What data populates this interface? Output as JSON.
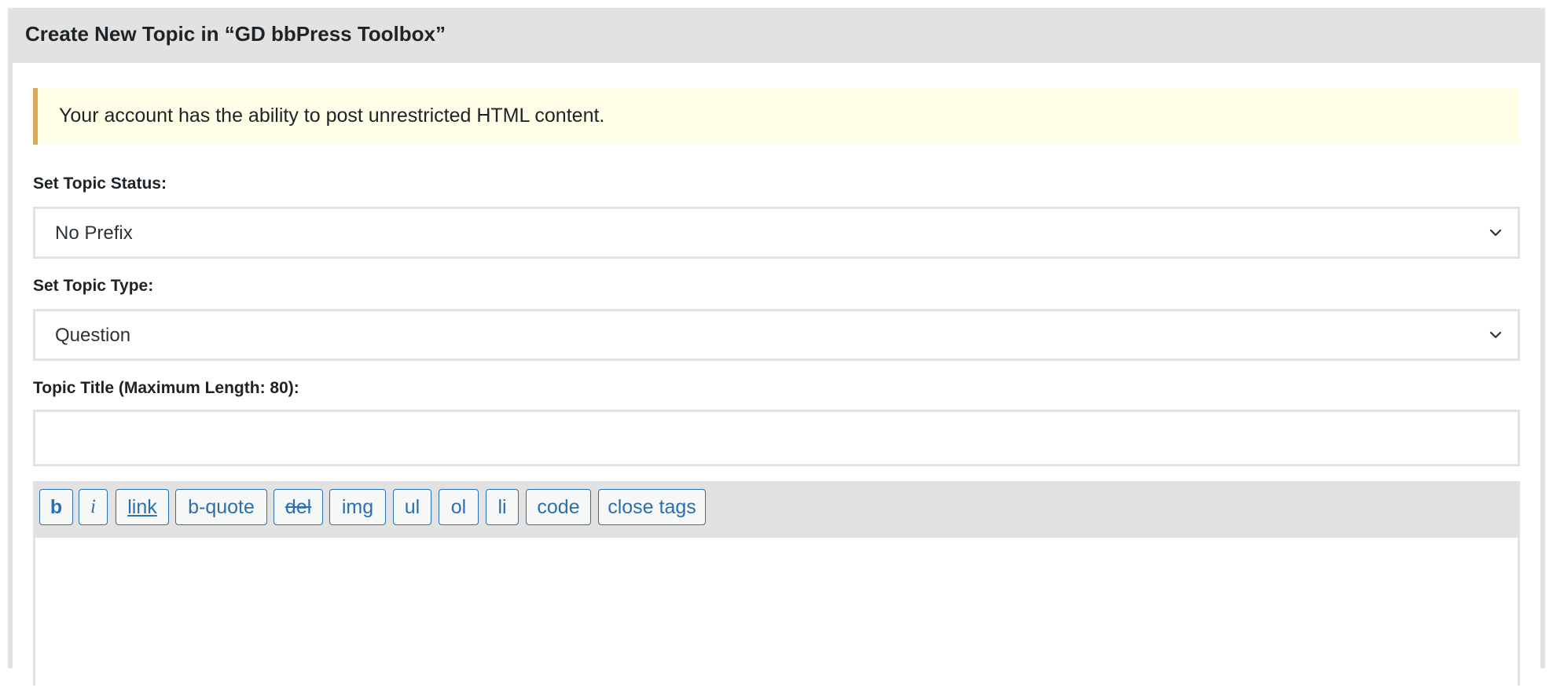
{
  "form": {
    "title": "Create New Topic in “GD bbPress Toolbox”",
    "notice": "Your account has the ability to post unrestricted HTML content.",
    "status_label": "Set Topic Status:",
    "status_value": "No Prefix",
    "type_label": "Set Topic Type:",
    "type_value": "Question",
    "title_label": "Topic Title (Maximum Length: 80):",
    "title_value": ""
  },
  "toolbar": {
    "b": "b",
    "i": "i",
    "link": "link",
    "bquote": "b-quote",
    "del": "del",
    "img": "img",
    "ul": "ul",
    "ol": "ol",
    "li": "li",
    "code": "code",
    "close_tags": "close tags"
  },
  "colors": {
    "accent": "#2c6fad",
    "notice_border": "#dba95a",
    "notice_bg": "#fffee7",
    "panel_bg": "#e2e2e2"
  },
  "icons": {
    "select_arrow": "chevron-down-icon"
  }
}
